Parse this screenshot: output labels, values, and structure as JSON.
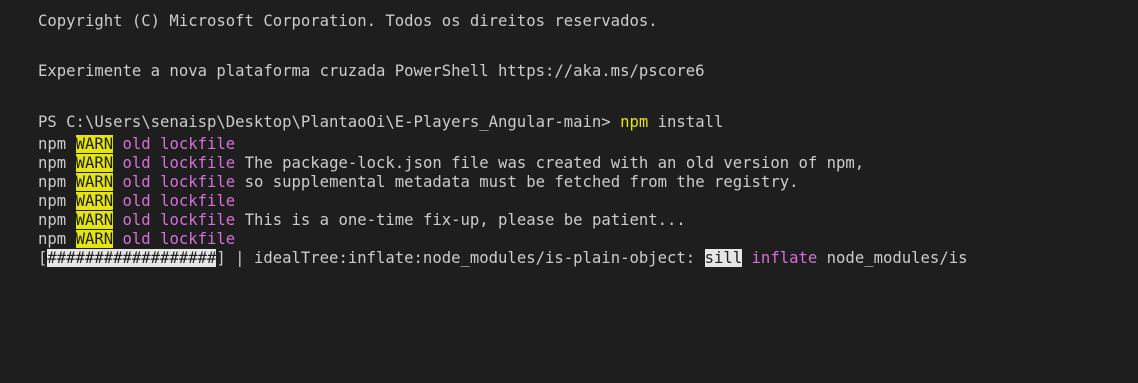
{
  "lines": {
    "copyright": "Copyright (C) Microsoft Corporation. Todos os direitos reservados.",
    "try_powershell": "Experimente a nova plataforma cruzada PowerShell https://aka.ms/pscore6",
    "prompt": "PS C:\\Users\\senaisp\\Desktop\\PlantaoOi\\E-Players_Angular-main> ",
    "command": "npm",
    "command_arg": " install"
  },
  "warn_lines": [
    {
      "prefix": "npm ",
      "level": "WARN",
      "tag": " old lockfile",
      "message": ""
    },
    {
      "prefix": "npm ",
      "level": "WARN",
      "tag": " old lockfile",
      "message": " The package-lock.json file was created with an old version of npm,"
    },
    {
      "prefix": "npm ",
      "level": "WARN",
      "tag": " old lockfile",
      "message": " so supplemental metadata must be fetched from the registry."
    },
    {
      "prefix": "npm ",
      "level": "WARN",
      "tag": " old lockfile",
      "message": ""
    },
    {
      "prefix": "npm ",
      "level": "WARN",
      "tag": " old lockfile",
      "message": " This is a one-time fix-up, please be patient..."
    },
    {
      "prefix": "npm ",
      "level": "WARN",
      "tag": " old lockfile",
      "message": ""
    }
  ],
  "progress": {
    "open": "[",
    "bar": "##################",
    "close": "]",
    "status": " | idealTree:inflate:node_modules/is-plain-object: ",
    "level": "sill",
    "action": " inflate",
    "path": " node_modules/is"
  },
  "colors": {
    "background": "#1e1e1e",
    "text": "#cccccc",
    "warn_bg": "#e5e510",
    "magenta": "#d670d6",
    "command": "#e5e510"
  }
}
